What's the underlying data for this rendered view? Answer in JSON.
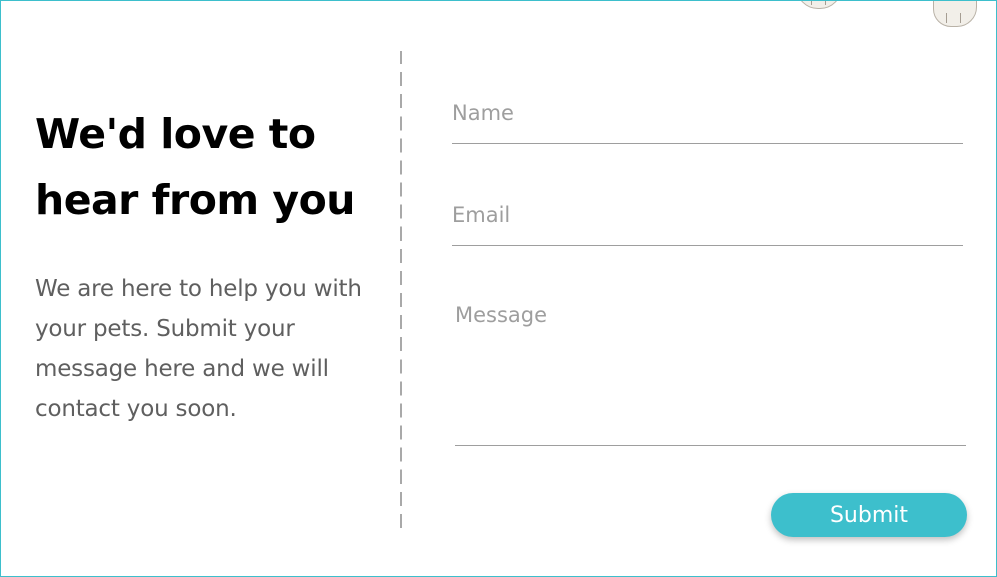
{
  "contact": {
    "headline": "We'd love to hear from you",
    "blurb": "We are here to help you with your pets. Submit your message here and we will contact you soon."
  },
  "form": {
    "name": {
      "placeholder": "Name",
      "value": ""
    },
    "email": {
      "placeholder": "Email",
      "value": ""
    },
    "message": {
      "placeholder": "Message",
      "value": ""
    },
    "submit_label": "Submit"
  },
  "colors": {
    "accent": "#3dbfcc",
    "headline": "#000000",
    "body_text": "#5f5f5f",
    "placeholder": "#9e9e9e"
  }
}
